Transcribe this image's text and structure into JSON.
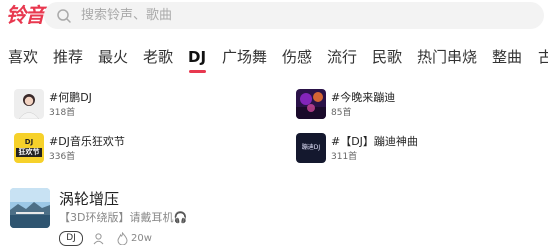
{
  "header": {
    "logo_text": "铃音",
    "search_placeholder": "搜索铃声、歌曲"
  },
  "tabs": [
    "喜欢",
    "推荐",
    "最火",
    "老歌",
    "DJ",
    "广场舞",
    "伤感",
    "流行",
    "民歌",
    "热门串烧",
    "整曲",
    "古"
  ],
  "active_tab": "DJ",
  "playlists": [
    {
      "title": "#何鹏DJ",
      "count": "318首"
    },
    {
      "title": "#今晚来蹦迪",
      "count": "85首"
    },
    {
      "title": "#DJ音乐狂欢节",
      "count": "336首"
    },
    {
      "title": "#【DJ】蹦迪神曲",
      "count": "311首"
    }
  ],
  "playlist_thumb_text": {
    "dj_party_line1": "DJ",
    "dj_party_line2": "狂欢节",
    "beng_di": "蹦迪DJ"
  },
  "song": {
    "name": "涡轮增压",
    "subtitle": "【3D环绕版】请戴耳机🎧",
    "badge": "DJ",
    "plays": "20w"
  },
  "colors": {
    "accent": "#e8384f",
    "search_bg": "#f3f3f3",
    "text_primary": "#222222",
    "text_secondary": "#888888"
  },
  "icons": {
    "search": "search-icon",
    "user": "user-icon",
    "fire": "fire-icon"
  }
}
